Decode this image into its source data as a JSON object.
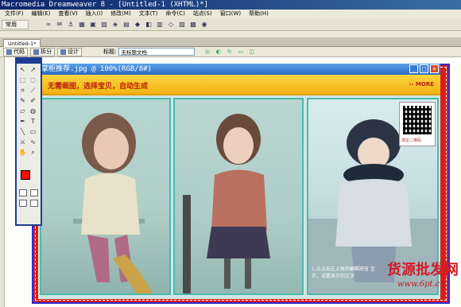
{
  "window": {
    "title": "Macromedia Dreamweaver 8 - [Untitled-1 (XHTML)*]"
  },
  "menu": [
    "文件(F)",
    "编辑(E)",
    "查看(V)",
    "插入(I)",
    "修改(M)",
    "文本(T)",
    "命令(C)",
    "站点(S)",
    "窗口(W)",
    "帮助(H)"
  ],
  "insert_bar": {
    "category": "常用"
  },
  "document_tab": {
    "label": "Untitled-1*"
  },
  "doc_toolbar": {
    "code_label": "代码",
    "split_label": "拆分",
    "design_label": "设计",
    "title_label": "标题:",
    "title_value": "无标题文档"
  },
  "image_window": {
    "title": "掌柜推荐.jpg @ 100%(RGB/8#)"
  },
  "banner": {
    "text": "无需裁图，选择宝贝，自动生成",
    "more": "MORE"
  },
  "qr_caption": "淘宝二维码",
  "photo_caption": "1.点点击左上角的编辑按钮\n宝贝，设置显示的文字",
  "watermark": {
    "site_cn": "货源批发网",
    "site_url": "www.6pt.cn"
  },
  "colors": {
    "frame": "#2e2ad7",
    "border_red": "#d91e17",
    "banner_yellow": "#fbd53e",
    "foreground_swatch": "#ff0a0a"
  }
}
